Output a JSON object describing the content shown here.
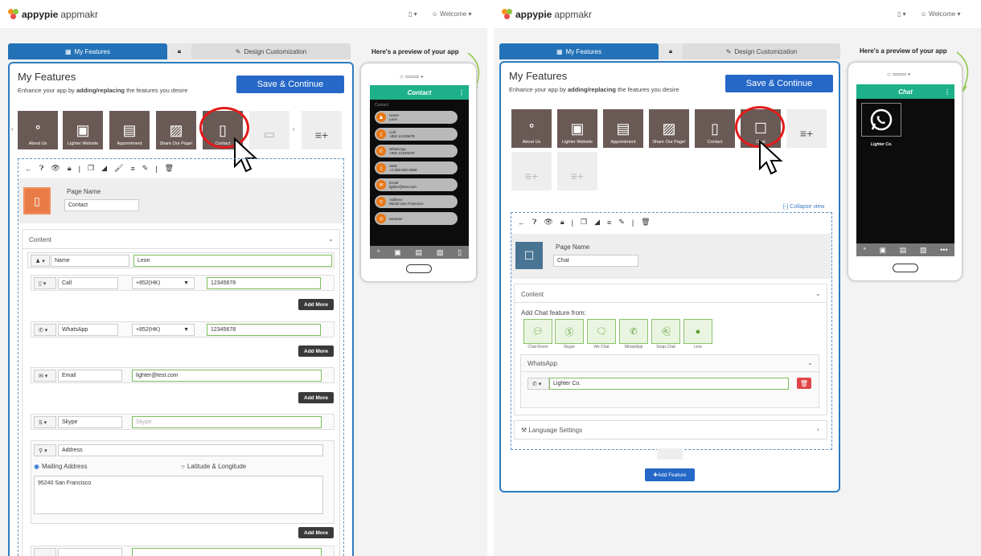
{
  "brand": {
    "name": "appypie",
    "suffix": "appmakr"
  },
  "topbar": {
    "welcome": "Welcome"
  },
  "tabs": {
    "features": "My Features",
    "design": "Design Customization"
  },
  "header": {
    "title": "My Features",
    "subtitle_pre": "Enhance your app by ",
    "subtitle_bold": "adding/replacing",
    "subtitle_post": " the features you desire",
    "save": "Save & Continue"
  },
  "preview_title": "Here's a preview of your app",
  "left": {
    "tiles": [
      "About Us",
      "Lighter Website",
      "Appointment",
      "Share Our Page!",
      "Contact"
    ],
    "page_name_label": "Page Name",
    "page_name": "Contact",
    "content_label": "Content",
    "rows": [
      {
        "type": "Name",
        "value": "Leon"
      },
      {
        "type": "Call",
        "code": "+852(HK)",
        "value": "12345678"
      },
      {
        "type": "WhatsApp",
        "code": "+852(HK)",
        "value": "12345678"
      },
      {
        "type": "Email",
        "value": "lighter@test.com"
      },
      {
        "type": "Skype",
        "placeholder": "Skype"
      },
      {
        "type": "Address"
      }
    ],
    "add_more": "Add More",
    "radio1": "Mailing Address",
    "radio2": "Latitude & Longitude",
    "address": "95240 San Francisco",
    "preview": {
      "screen_title": "Contact",
      "section": "Contact",
      "items": [
        {
          "t": "Name",
          "v": "Leon"
        },
        {
          "t": "Call",
          "v": "+852 12345678"
        },
        {
          "t": "WhatsApp",
          "v": "+852 12345678"
        },
        {
          "t": "SMS",
          "v": "+1 000-000-0000"
        },
        {
          "t": "Email",
          "v": "lighter@test.com"
        },
        {
          "t": "Address",
          "v": "95240 San Francisco"
        },
        {
          "t": "Website",
          "v": ""
        }
      ]
    }
  },
  "right": {
    "tiles": [
      "About Us",
      "Lighter Website",
      "Appointment",
      "Share Our Page!",
      "Contact",
      "Chat"
    ],
    "collapse": "[-] Collapse view",
    "page_name_label": "Page Name",
    "page_name": "Chat",
    "content_label": "Content",
    "add_from": "Add Chat feature from:",
    "chat_options": [
      "Chat Room",
      "Skype",
      "We Chat",
      "WhatsApp",
      "Snap Chat",
      "Line"
    ],
    "whatsapp_label": "WhatsApp",
    "whatsapp_value": "Lighter Co.",
    "lang": "Language Settings",
    "add_feature": "Add Feature",
    "preview": {
      "screen_title": "Chat",
      "contact": "Lighter Co."
    }
  }
}
